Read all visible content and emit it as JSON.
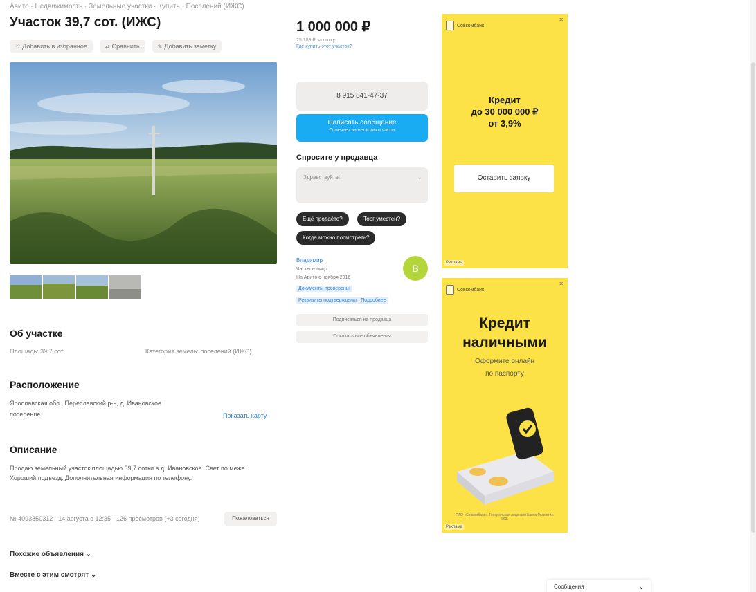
{
  "breadcrumbs": "Авито · Недвижимость · Земельные участки · Купить · Поселений (ИЖС)",
  "title": "Участок 39,7 сот. (ИЖС)",
  "actions": [
    {
      "icon": "heart-icon",
      "label": "Добавить в избранное"
    },
    {
      "icon": "compare-icon",
      "label": "Сравнить"
    },
    {
      "icon": "note-icon",
      "label": "Добавить заметку"
    }
  ],
  "about": {
    "title": "Об участке",
    "area": "Площадь: 39,7 сот.",
    "category": "Категория земель: поселений (ИЖС)"
  },
  "location": {
    "title": "Расположение",
    "address": "Ярославская обл., Переславский р-н, д. Ивановское",
    "district": "поселение",
    "map_link": "Показать карту"
  },
  "description": {
    "title": "Описание",
    "text": "Продаю земельный участок площадью 39,7 сотки в д. Ивановское. Свет по меже. Хороший подъезд. Дополнительная информация по телефону."
  },
  "ad_meta": "№ 4093850312 · 14 августа в 12:35 · 126 просмотров (+3 сегодня)",
  "report_label": "Пожаловаться",
  "bottom_links": [
    "Похожие объявления",
    "Вместе с этим смотрят"
  ],
  "price": {
    "value": "1 000 000 ₽",
    "sub": "25 189 ₽ за сотку",
    "link": "Где купить этот участок?"
  },
  "contact": {
    "phone": "8 915 841-47-37",
    "message_title": "Написать сообщение",
    "message_sub": "Отвечает за несколько часов"
  },
  "ask": {
    "title": "Спросите у продавца",
    "placeholder": "Здравствуйте!",
    "chips": [
      "Ещё продаёте?",
      "Торг уместен?",
      "Когда можно посмотреть?"
    ]
  },
  "seller": {
    "name": "Владимир",
    "type": "Частное лицо",
    "since": "На Авито с ноября 2016",
    "tags": [
      "Документы проверены",
      "Реквизиты подтверждены · Подробнее"
    ],
    "avatar_letter": "В",
    "buttons": [
      "Подписаться на продавца",
      "Показать все объявления"
    ]
  },
  "ads": [
    {
      "brand": "Совкомбанк",
      "headline": [
        "Кредит",
        "до 30 000 000 ₽",
        "от 3,9%"
      ],
      "button": "Оставить заявку",
      "tag": "Реклама"
    },
    {
      "brand": "Совкомбанк",
      "headline": [
        "Кредит",
        "наличными"
      ],
      "sub": [
        "Оформите онлайн",
        "по паспорту"
      ],
      "disclaimer": "ПАО «Совкомбанк». Генеральная лицензия Банка России № 963.",
      "tag": "Реклама"
    }
  ],
  "chat": {
    "label": "Сообщения"
  },
  "colors": {
    "accent_blue": "#1aacf2",
    "ad_yellow": "#fde247",
    "avatar_green": "#b5d63a"
  }
}
